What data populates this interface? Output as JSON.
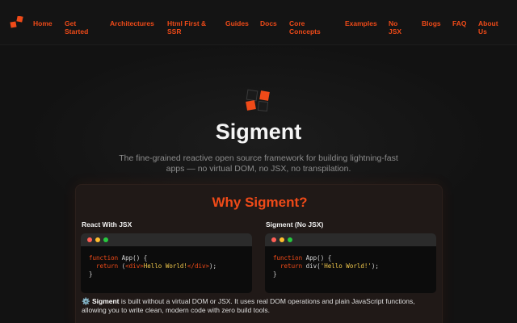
{
  "nav": {
    "items": [
      {
        "label": "Home"
      },
      {
        "label": "Get Started"
      },
      {
        "label": "Architectures"
      },
      {
        "label": "Html First & SSR"
      },
      {
        "label": "Guides"
      },
      {
        "label": "Docs"
      },
      {
        "label": "Core Concepts"
      },
      {
        "label": "Examples"
      },
      {
        "label": "No JSX"
      },
      {
        "label": "Blogs"
      },
      {
        "label": "FAQ"
      },
      {
        "label": "About Us"
      }
    ]
  },
  "hero": {
    "title": "Sigment",
    "subtitle": "The fine-grained reactive open source framework for building lightning-fast apps — no virtual DOM, no JSX, no transpilation."
  },
  "why": {
    "title": "Why Sigment?",
    "left_heading": "React With JSX",
    "right_heading": "Sigment (No JSX)",
    "left_code": {
      "line1_kw": "function",
      "line1_rest": " App() {",
      "line2_kw": "return",
      "line2_open": " (",
      "line2_tag_open": "<div>",
      "line2_text": "Hello World!",
      "line2_tag_close": "</div>",
      "line2_end": ");",
      "line3": "}"
    },
    "right_code": {
      "line1_kw": "function",
      "line1_rest": " App() {",
      "line2_kw": "return",
      "line2_call": " div(",
      "line2_str": "'Hello World!'",
      "line2_end": ");",
      "line3": "}"
    },
    "desc_icon": "⚙️",
    "desc_bold": "Sigment",
    "desc_rest": " is built without a virtual DOM or JSX. It uses real DOM operations and plain JavaScript functions, allowing you to write clean, modern code with zero build tools."
  },
  "colors": {
    "accent": "#ef4a18",
    "background": "#121212",
    "dot_red": "#ff5f56",
    "dot_yellow": "#ffbd2e",
    "dot_green": "#27c93f"
  },
  "icons": {
    "logo": "sigment-logo-icon",
    "window_dots": [
      "red-dot-icon",
      "yellow-dot-icon",
      "green-dot-icon"
    ]
  }
}
